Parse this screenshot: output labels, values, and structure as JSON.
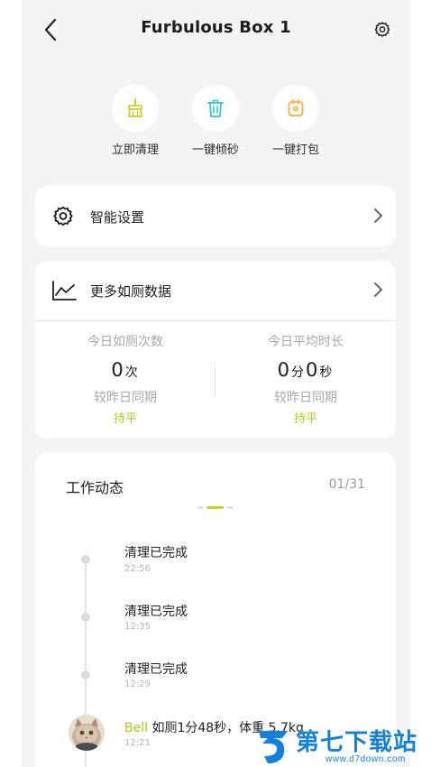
{
  "header": {
    "title": "Furbulous Box 1",
    "back_icon": "chevron-left-icon",
    "settings_icon": "gear-icon"
  },
  "actions": [
    {
      "label": "立即清理",
      "icon": "broom-icon",
      "color": "#c6d12a"
    },
    {
      "label": "一键倾砂",
      "icon": "trash-can-icon",
      "color": "#34c3d6"
    },
    {
      "label": "一键打包",
      "icon": "package-icon",
      "color": "#f2b233"
    }
  ],
  "smart_settings": {
    "label": "智能设置",
    "icon": "gear-icon"
  },
  "toilet_data": {
    "label": "更多如厕数据",
    "icon": "line-chart-icon",
    "left": {
      "title": "今日如厕次数",
      "value": "0",
      "unit": "次",
      "compare_label": "较昨日同期",
      "trend": "持平"
    },
    "right": {
      "title": "今日平均时长",
      "minutes": "0",
      "minutes_unit": "分",
      "seconds": "0",
      "seconds_unit": "秒",
      "compare_label": "较昨日同期",
      "trend": "持平"
    }
  },
  "activity": {
    "title": "工作动态",
    "count": "01/31",
    "items": [
      {
        "text": "清理已完成",
        "time": "22:56"
      },
      {
        "text": "清理已完成",
        "time": "12:35"
      },
      {
        "text": "清理已完成",
        "time": "12:29"
      }
    ],
    "last": {
      "user": "Bell",
      "text": "如厕1分48秒，体重 5.7kg",
      "time": "12:21"
    }
  },
  "watermark": {
    "text": "第七下载站",
    "url": "www.d7down.com"
  },
  "colors": {
    "accent": "#b8c61c",
    "background": "#f4f4f4",
    "card": "#ffffff",
    "watermark": "#1681d8"
  }
}
